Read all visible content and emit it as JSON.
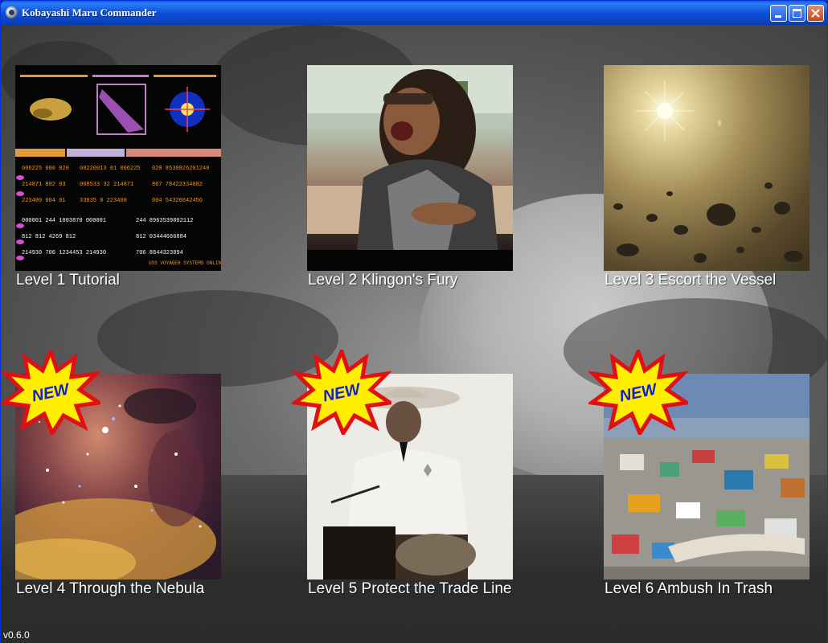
{
  "window": {
    "title": "Kobayashi Maru Commander"
  },
  "levels": [
    {
      "label": "Level 1 Tutorial",
      "is_new": false,
      "image": "lcars-display-image"
    },
    {
      "label": "Level 2 Klingon's Fury",
      "is_new": false,
      "image": "klingon-warrior-image"
    },
    {
      "label": "Level 3 Escort the Vessel",
      "is_new": false,
      "image": "asteroid-field-image"
    },
    {
      "label": "Level 4 Through the Nebula",
      "is_new": true,
      "image": "nebula-image"
    },
    {
      "label": "Level 5 Protect the Trade Line",
      "is_new": true,
      "image": "cowboy-image"
    },
    {
      "label": "Level 6 Ambush In Trash",
      "is_new": true,
      "image": "trash-beach-image"
    }
  ],
  "badge_text": "NEW",
  "version": "v0.6.0",
  "colors": {
    "titlebar": "#0b52d8",
    "badge_fill": "#ffee00",
    "badge_stroke": "#e01010",
    "badge_text": "#1020d0"
  }
}
